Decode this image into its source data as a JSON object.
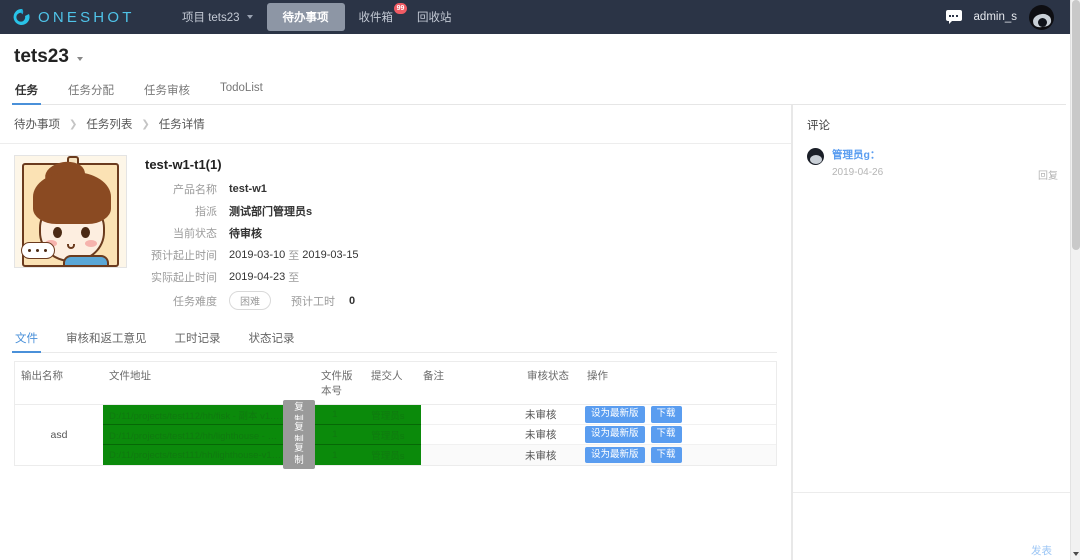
{
  "topnav": {
    "brand": "ONESHOT",
    "brand_icon": "oneshot-logo-icon",
    "project_label": "项目 tets23",
    "items": [
      {
        "label": "待办事项",
        "selected": true
      },
      {
        "label": "收件箱",
        "selected": false,
        "badge": "99"
      },
      {
        "label": "回收站",
        "selected": false
      }
    ],
    "chat_icon": "chat-bubble-icon",
    "user": "admin_s"
  },
  "page": {
    "title": "tets23",
    "tabs": [
      {
        "label": "任务",
        "active": true
      },
      {
        "label": "任务分配",
        "active": false
      },
      {
        "label": "任务审核",
        "active": false
      },
      {
        "label": "TodoList",
        "active": false
      }
    ]
  },
  "breadcrumb": [
    "待办事项",
    "任务列表",
    "任务详情"
  ],
  "detail": {
    "thumb_alt": "task-thumbnail",
    "task_name": "test-w1-t1(1)",
    "fields": [
      {
        "label": "产品名称",
        "value": "test-w1"
      },
      {
        "label": "指派",
        "value": "测试部门管理员s"
      },
      {
        "label": "当前状态",
        "value": "待审核"
      }
    ],
    "plan_label": "预计起止时间",
    "plan_start": "2019-03-10",
    "plan_sep": "至",
    "plan_end": "2019-03-15",
    "actual_label": "实际起止时间",
    "actual_start": "2019-04-23",
    "actual_sep": "至",
    "actual_end": "",
    "difficulty_label": "任务难度",
    "difficulty_value": "困难",
    "hours_label": "预计工时",
    "hours_value": "0"
  },
  "inner_tabs": [
    {
      "label": "文件",
      "active": true
    },
    {
      "label": "审核和返工意见",
      "active": false
    },
    {
      "label": "工时记录",
      "active": false
    },
    {
      "label": "状态记录",
      "active": false
    }
  ],
  "table": {
    "columns": [
      "输出名称",
      "文件地址",
      "文件版本号",
      "提交人",
      "备注",
      "审核状态",
      "操作"
    ],
    "group_name": "asd",
    "copy_label": "复制",
    "set_latest_label": "设为最新版",
    "download_label": "下载",
    "rows": [
      {
        "path": "D:/11/projects/test112/hh/fisk - 副本 v1.jpg",
        "version": "1",
        "submitter": "管理员s",
        "note": "",
        "status": "未审核"
      },
      {
        "path": "D:/11/projects/test112/hh/lighthouse - 副本 v1.jpg",
        "version": "1",
        "submitter": "管理员s",
        "note": "",
        "status": "未审核"
      },
      {
        "path": "D:/11/projects/test111/hh/lighthouse-v1.jpg",
        "version": "1",
        "submitter": "管理员s",
        "note": "",
        "status": "未审核"
      }
    ]
  },
  "comments": {
    "title": "评论",
    "entries": [
      {
        "user": "管理员g：",
        "date": "2019-04-26",
        "reply_label": "回复",
        "text": ""
      }
    ],
    "input_value": "",
    "input_placeholder": "",
    "post_label": "发表"
  },
  "colors": {
    "nav_bg": "#2b3446",
    "brand": "#4fc3e8",
    "accent": "#4a90d9",
    "button_blue": "#5a9df0",
    "highlight_green": "#0b8a0b",
    "badge_red": "#f05b64"
  }
}
